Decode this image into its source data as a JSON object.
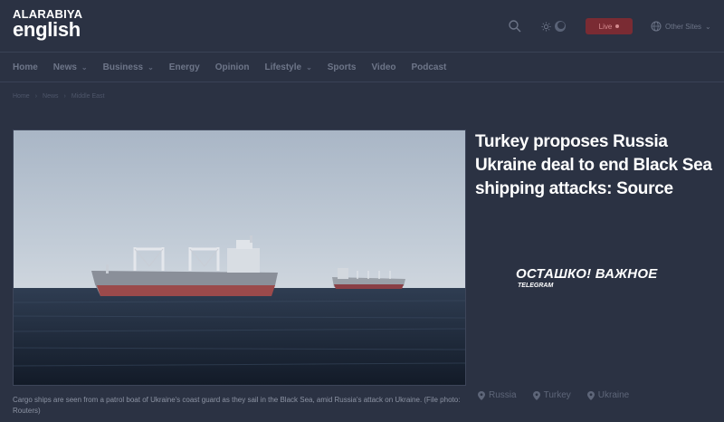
{
  "header": {
    "logo_top": "ALARABIYA",
    "logo_bottom": "english",
    "search_icon": "search-icon",
    "theme_icons": [
      "sun-icon",
      "moon-icon"
    ],
    "live_label": "Live",
    "other_sites_label": "Other Sites"
  },
  "nav": {
    "items": [
      {
        "label": "Home",
        "has_dropdown": false
      },
      {
        "label": "News",
        "has_dropdown": true
      },
      {
        "label": "Business",
        "has_dropdown": true
      },
      {
        "label": "Energy",
        "has_dropdown": false
      },
      {
        "label": "Opinion",
        "has_dropdown": false
      },
      {
        "label": "Lifestyle",
        "has_dropdown": true
      },
      {
        "label": "Sports",
        "has_dropdown": false
      },
      {
        "label": "Video",
        "has_dropdown": false
      },
      {
        "label": "Podcast",
        "has_dropdown": false
      }
    ]
  },
  "breadcrumb": [
    "Home",
    "News",
    "Middle East"
  ],
  "article": {
    "title": "Turkey proposes Russia Ukraine deal to end Black Sea shipping attacks: Source",
    "caption": "Cargo ships are seen from a patrol boat of Ukraine's coast guard as they sail in the Black Sea, amid Russia's attack on Ukraine. (File photo: Routers)",
    "tags": [
      "Russia",
      "Turkey",
      "Ukraine"
    ]
  },
  "watermark": {
    "main": "ОСТАШКО! ВАЖНОЕ",
    "sub": "TELEGRAM"
  },
  "colors": {
    "background": "#2b3243",
    "live_button": "#7a2b33",
    "text_primary": "#ffffff",
    "text_muted": "#6e7689"
  }
}
